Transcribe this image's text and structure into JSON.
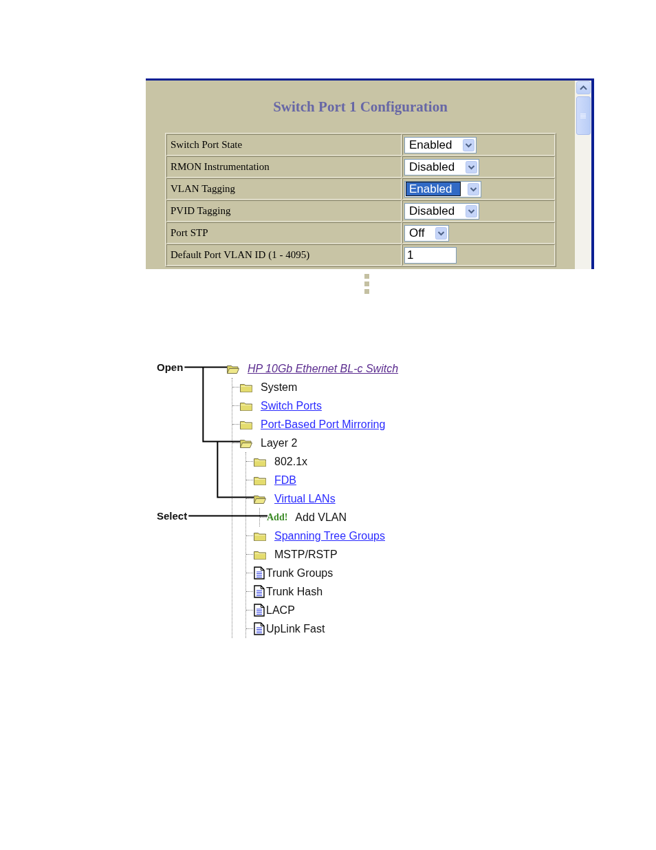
{
  "config_panel": {
    "title": "Switch Port 1 Configuration",
    "rows": [
      {
        "label": "Switch Port State",
        "kind": "select",
        "value": "Enabled",
        "focused": false
      },
      {
        "label": "RMON Instrumentation",
        "kind": "select",
        "value": "Disabled",
        "focused": false
      },
      {
        "label": "VLAN Tagging",
        "kind": "select",
        "value": "Enabled",
        "focused": true
      },
      {
        "label": "PVID Tagging",
        "kind": "select",
        "value": "Disabled",
        "focused": false
      },
      {
        "label": "Port STP",
        "kind": "select",
        "value": "Off",
        "focused": false
      },
      {
        "label": "Default Port VLAN ID (1 - 4095)",
        "kind": "text",
        "value": "1"
      }
    ]
  },
  "nav_tree": {
    "label": "HP 10Gb Ethernet BL-c Switch",
    "kind": "folder",
    "expanded": true,
    "link": true,
    "visited": true,
    "children": [
      {
        "label": "System",
        "kind": "folder",
        "expanded": false,
        "link": false
      },
      {
        "label": "Switch Ports",
        "kind": "folder",
        "expanded": false,
        "link": true,
        "visited": false
      },
      {
        "label": "Port-Based Port Mirroring",
        "kind": "folder",
        "expanded": false,
        "link": true,
        "visited": false
      },
      {
        "label": "Layer 2",
        "kind": "folder",
        "expanded": true,
        "link": false,
        "children": [
          {
            "label": "802.1x",
            "kind": "folder",
            "expanded": false,
            "link": false
          },
          {
            "label": "FDB",
            "kind": "folder",
            "expanded": false,
            "link": true,
            "visited": false
          },
          {
            "label": "Virtual LANs",
            "kind": "folder",
            "expanded": true,
            "link": true,
            "visited": false,
            "children": [
              {
                "label": "Add VLAN",
                "kind": "action",
                "badge": "Add!",
                "link": false
              }
            ]
          },
          {
            "label": "Spanning Tree Groups",
            "kind": "folder",
            "expanded": false,
            "link": true,
            "visited": false
          },
          {
            "label": "MSTP/RSTP",
            "kind": "folder",
            "expanded": false,
            "link": false
          },
          {
            "label": "Trunk Groups",
            "kind": "page",
            "link": false
          },
          {
            "label": "Trunk Hash",
            "kind": "page",
            "link": false
          },
          {
            "label": "LACP",
            "kind": "page",
            "link": false
          },
          {
            "label": "UpLink Fast",
            "kind": "page",
            "link": false
          }
        ]
      }
    ]
  },
  "annotations": [
    {
      "label": "Open",
      "kind": "open"
    },
    {
      "label": "Select",
      "kind": "select"
    }
  ]
}
